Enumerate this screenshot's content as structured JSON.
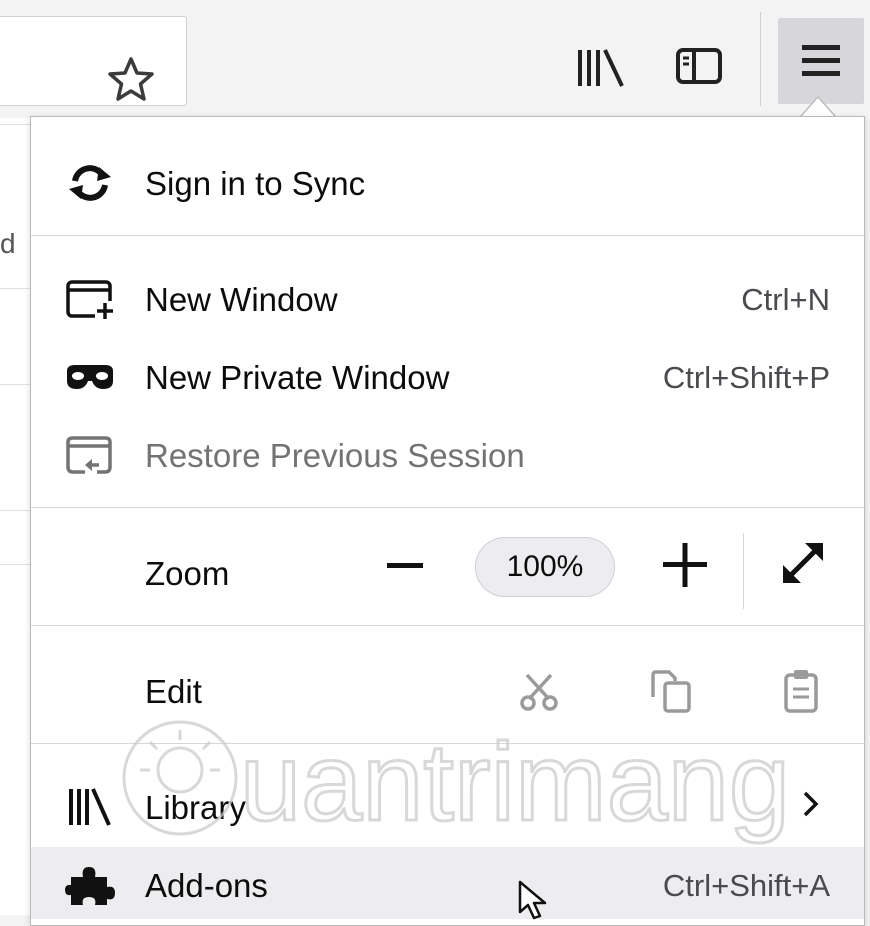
{
  "toolbar": {
    "icons": [
      "star-icon",
      "library-icon",
      "sidebar-icon",
      "hamburger-menu-icon"
    ]
  },
  "page_fragment": "d",
  "menu": {
    "sync": {
      "label": "Sign in to Sync",
      "icon": "sync-icon"
    },
    "new_window": {
      "label": "New Window",
      "shortcut": "Ctrl+N",
      "icon": "new-window-icon"
    },
    "new_private_window": {
      "label": "New Private Window",
      "shortcut": "Ctrl+Shift+P",
      "icon": "private-mask-icon"
    },
    "restore_session": {
      "label": "Restore Previous Session",
      "icon": "restore-session-icon"
    },
    "zoom": {
      "label": "Zoom",
      "value": "100%",
      "icons": [
        "minus-icon",
        "plus-icon",
        "fullscreen-icon"
      ]
    },
    "edit": {
      "label": "Edit",
      "icons": [
        "cut-icon",
        "copy-icon",
        "paste-icon"
      ]
    },
    "library": {
      "label": "Library",
      "icon": "library-icon"
    },
    "addons": {
      "label": "Add-ons",
      "shortcut": "Ctrl+Shift+A",
      "icon": "puzzle-icon"
    }
  },
  "watermark": "uantrimang",
  "colors": {
    "menu_bg": "#ffffff",
    "toolbar_bg": "#f3f3f3",
    "hover_bg": "#ededf0",
    "disabled_text": "#737373"
  }
}
